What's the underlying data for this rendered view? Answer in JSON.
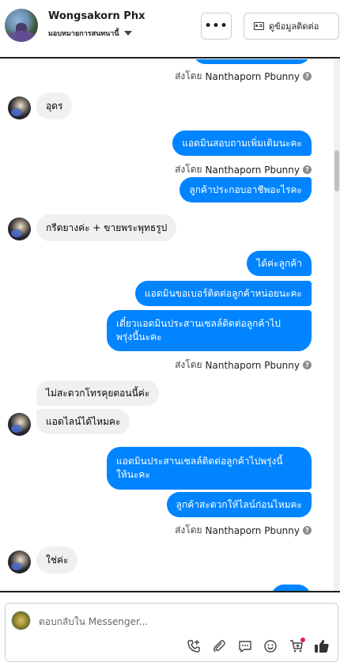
{
  "header": {
    "name": "Wongsakorn Phx",
    "assign_label": "มอบหมายการสนทนานี้",
    "more_label": "•••",
    "info_button_label": "ดูข้อมูลติดต่อ"
  },
  "messages": {
    "sent_by_prefix": "ส่งโดย",
    "sender_name": "Nanthaporn Pbunny",
    "m1": "อุดร",
    "m2": "แอดมินสอบถามเพิ่มเติมนะคะ",
    "m3": "ลูกค้าประกอบอาชีพอะไรคะ",
    "m4": "กรีดยางค่ะ + ขายพระพุทธรูป",
    "m5": "ได้ค่ะลูกค้า",
    "m6": "แอดมินขอเบอร์ติดต่อลูกค้าหน่อยนะคะ",
    "m7_line1": "เดี๋ยวแอดมินประสานเซลล์ติดต่อลูกค้าไป",
    "m7_line2": "พรุ่งนี้นะคะ",
    "m8": "ไม่สะดวกโทรคุยตอนนี้ค่ะ",
    "m9": "แอดไลน์ได้ไหมคะ",
    "m10_line1": "แอดมินประสานเซลล์ติดต่อลูกค้าไปพรุ่งนี้",
    "m10_line2": "ให้นะคะ",
    "m11": "ลูกค้าสะดวกให้ไลน์ก่อนไหมคะ",
    "m12": "ใช่ค่ะ"
  },
  "composer": {
    "placeholder": "ตอบกลับใน Messenger..."
  },
  "icons": {
    "call": "call-add-icon",
    "attach": "paperclip-icon",
    "saved_reply": "saved-reply-icon",
    "emoji": "emoji-icon",
    "cart": "cart-icon",
    "like": "thumbs-up-icon"
  },
  "colors": {
    "outgoing_bubble": "#0084ff",
    "incoming_bubble": "#f0f0f0",
    "notification_dot": "#e41e3f"
  }
}
